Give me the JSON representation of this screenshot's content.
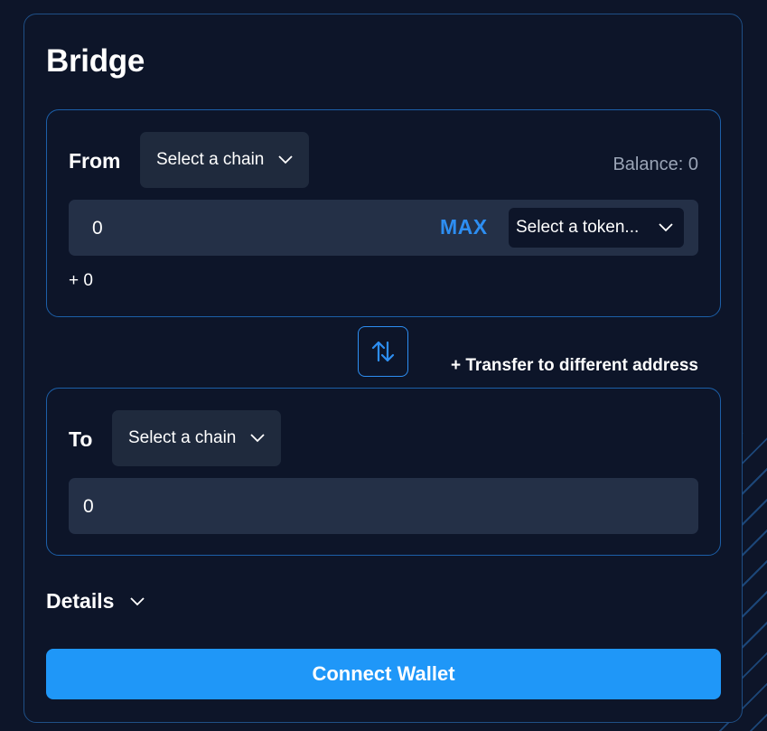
{
  "bridge": {
    "title": "Bridge",
    "from": {
      "label": "From",
      "chain_select": "Select a chain",
      "balance_label": "Balance:",
      "balance_value": "0",
      "amount": "0",
      "max_label": "MAX",
      "token_select": "Select a token...",
      "usd_value": "+ 0"
    },
    "swap_icon": "swap-arrows-icon",
    "transfer_link": "+ Transfer to different address",
    "to": {
      "label": "To",
      "chain_select": "Select a chain",
      "amount": "0"
    },
    "details_label": "Details",
    "connect_button": "Connect Wallet"
  },
  "colors": {
    "background": "#0d1529",
    "border": "#1c5fa8",
    "accent": "#1f97f8",
    "max": "#2d8ef2",
    "field": "#243047",
    "muted": "#9aa4b6"
  }
}
